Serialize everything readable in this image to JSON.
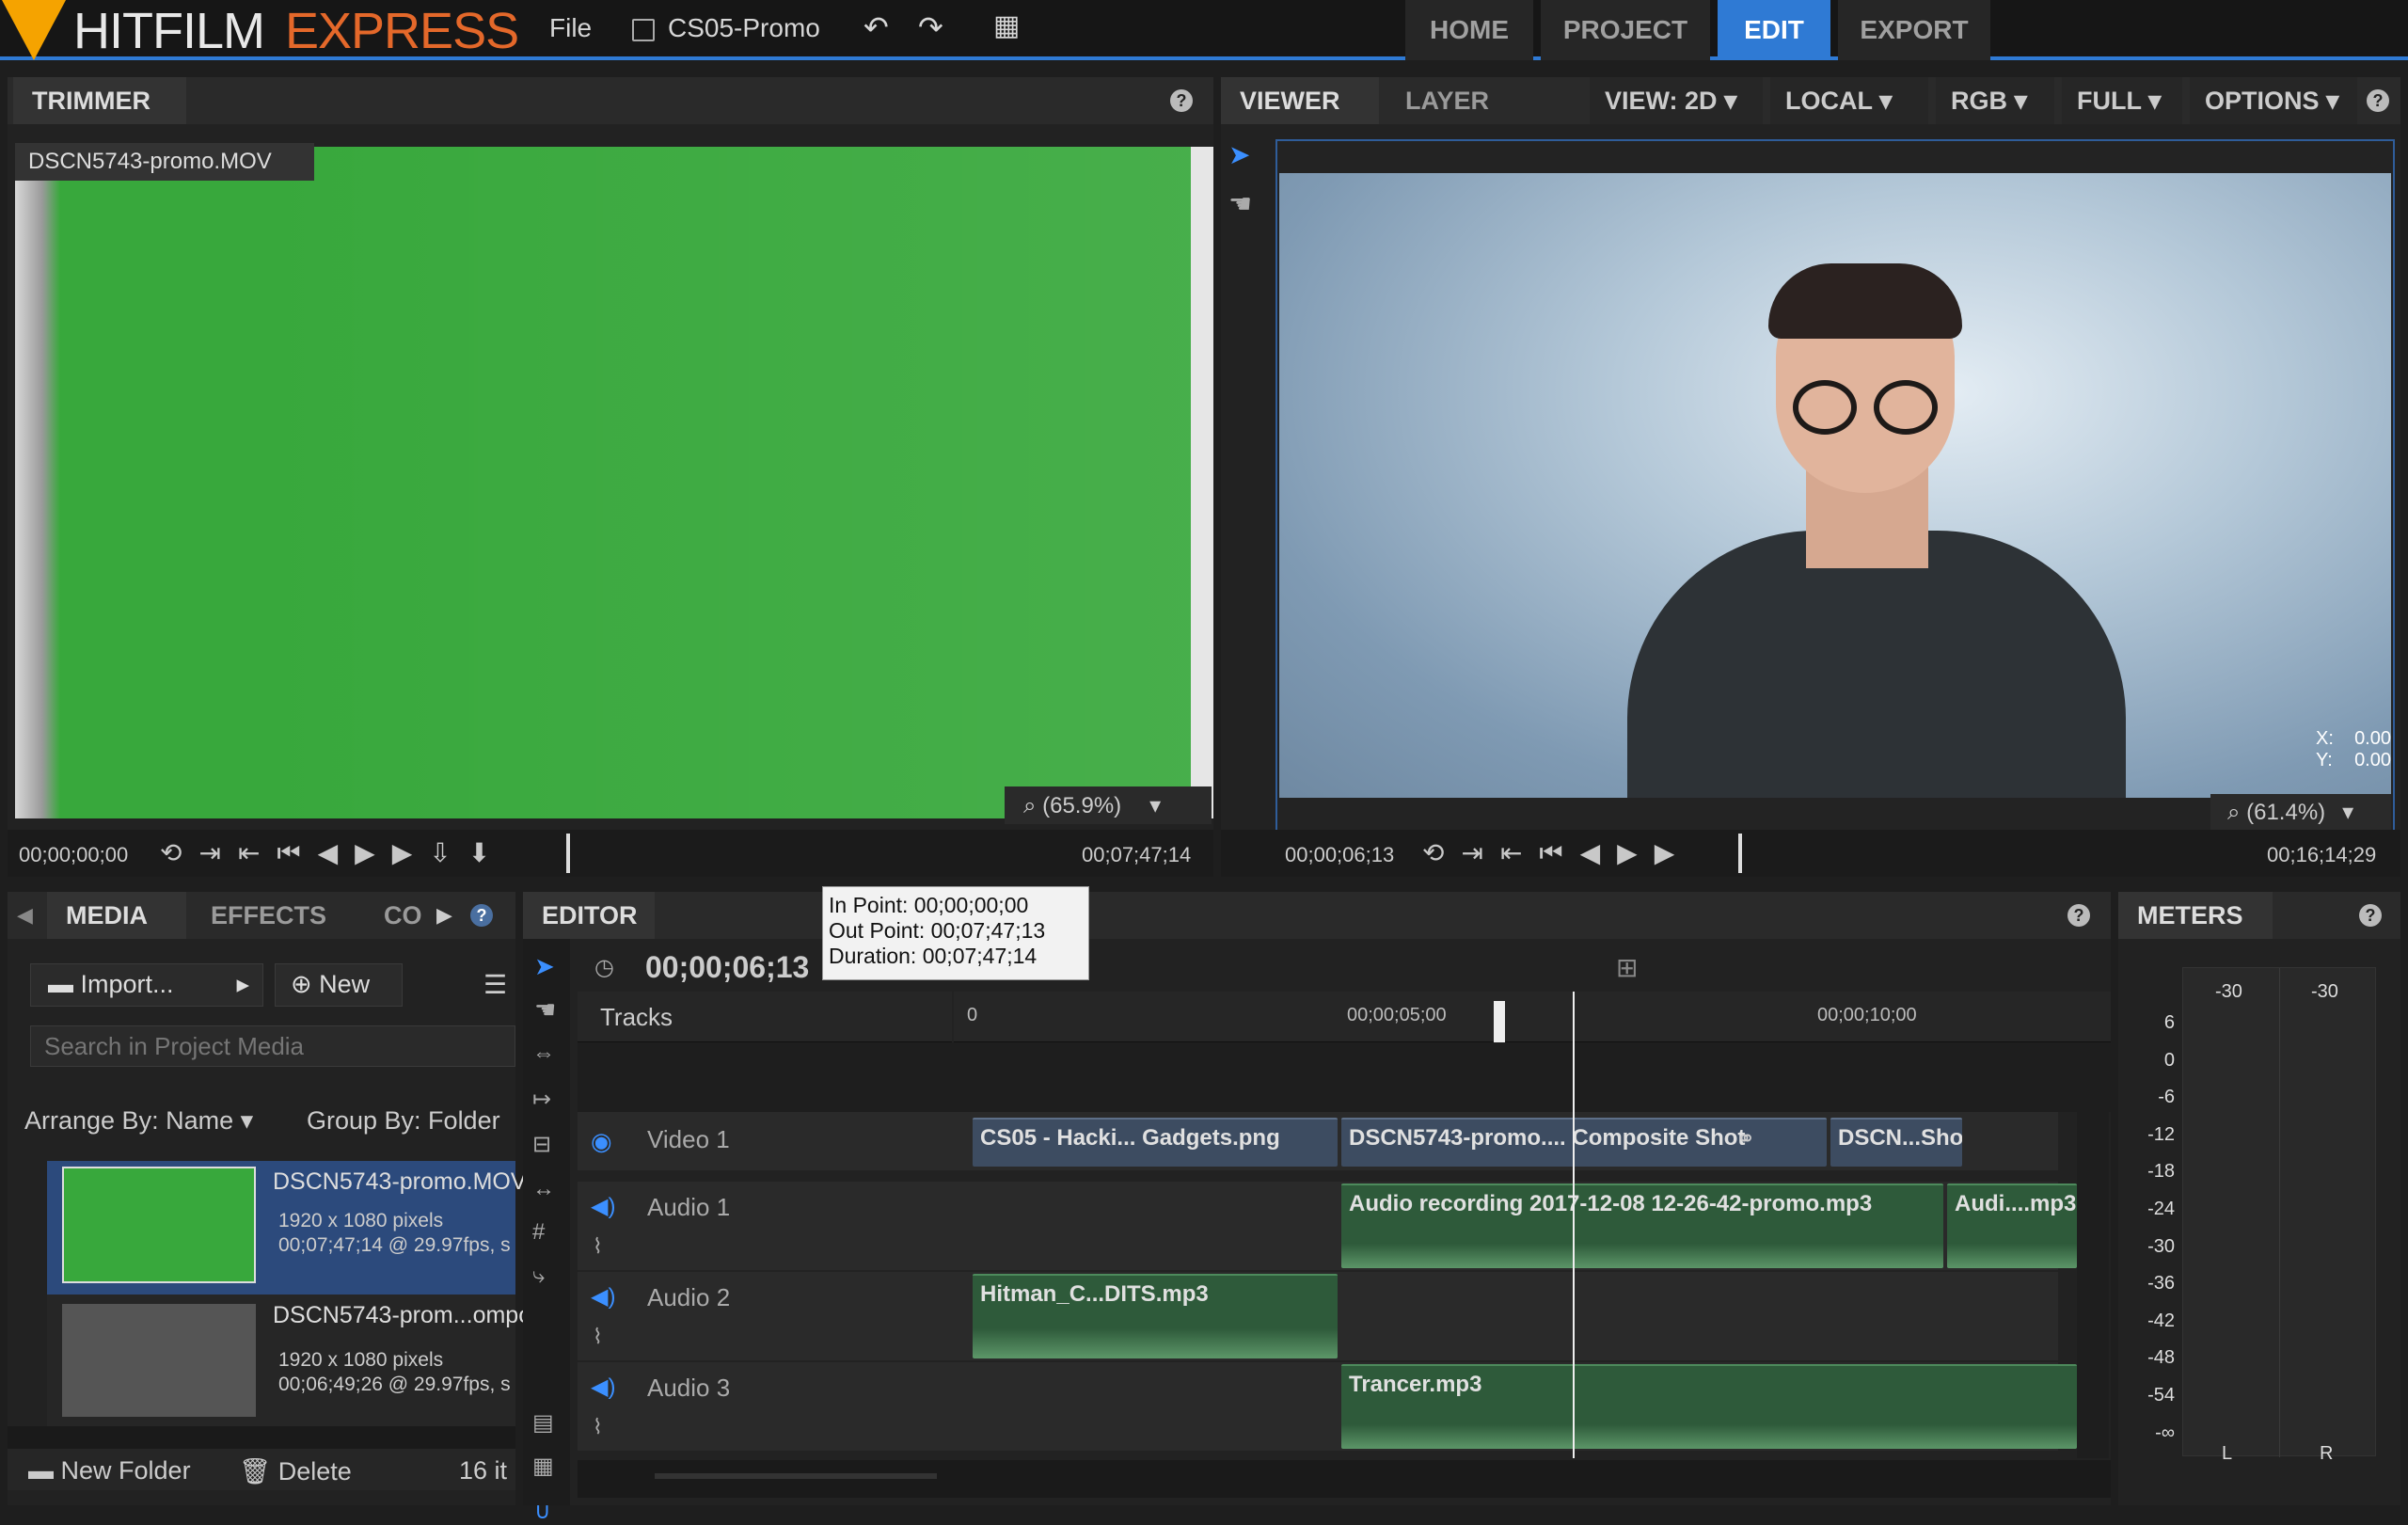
{
  "app": {
    "name_left": "HITFILM",
    "name_right": "EXPRESS",
    "file_menu": "File",
    "project_name": "CS05-Promo"
  },
  "nav": {
    "tabs": [
      "HOME",
      "PROJECT",
      "EDIT",
      "EXPORT"
    ],
    "active": "EDIT"
  },
  "trimmer": {
    "tab": "TRIMMER",
    "clip_label": "DSCN5743-promo.MOV",
    "zoom": "(65.9%)",
    "time_left": "00;00;00;00",
    "time_right": "00;07;47;14"
  },
  "viewer": {
    "tabs": [
      "VIEWER",
      "LAYER"
    ],
    "view": "VIEW: 2D",
    "local": "LOCAL",
    "rgb": "RGB",
    "full": "FULL",
    "options": "OPTIONS",
    "x_label": "X:",
    "x_val": "0.00",
    "y_label": "Y:",
    "y_val": "0.00",
    "zoom": "(61.4%)",
    "time_left": "00;00;06;13",
    "time_right": "00;16;14;29"
  },
  "media": {
    "tabs": [
      "MEDIA",
      "EFFECTS",
      "CO"
    ],
    "import": "Import...",
    "new": "New",
    "search_placeholder": "Search in Project Media",
    "arrange": "Arrange By: Name",
    "group": "Group By: Folder",
    "items": [
      {
        "name": "DSCN5743-promo.MOV",
        "res": "1920 x 1080 pixels",
        "dur": "00;07;47;14 @ 29.97fps, s"
      },
      {
        "name": "DSCN5743-prom...ompo",
        "res": "1920 x 1080 pixels",
        "dur": "00;06;49;26 @ 29.97fps, s"
      }
    ],
    "new_folder": "New Folder",
    "delete": "Delete",
    "count": "16 it"
  },
  "editor": {
    "tab": "EDITOR",
    "timecode": "00;00;06;13",
    "tracks_label": "Tracks",
    "tooltip": {
      "in": "In Point: 00;00;00;00",
      "out": "Out Point: 00;07;47;13",
      "dur": "Duration: 00;07;47;14"
    },
    "ruler": [
      "0",
      "00;00;05;00",
      "00;00;10;00"
    ],
    "tracks": [
      {
        "name": "Video 1"
      },
      {
        "name": "Audio 1"
      },
      {
        "name": "Audio 2"
      },
      {
        "name": "Audio 3"
      }
    ],
    "clips": {
      "v1a": "CS05 - Hacki... Gadgets.png",
      "v1b": "DSCN5743-promo.... Composite Shot",
      "v1c": "DSCN...Shot",
      "a1a": "Audio recording 2017-12-08 12-26-42-promo.mp3",
      "a1b": "Audi....mp3",
      "a2a": "Hitman_C...DITS.mp3",
      "a3a": "Trancer.mp3"
    }
  },
  "meters": {
    "tab": "METERS",
    "top_left": "-30",
    "top_right": "-30",
    "scale": [
      "6",
      "0",
      "-6",
      "-12",
      "-18",
      "-24",
      "-30",
      "-36",
      "-42",
      "-48",
      "-54",
      "-∞"
    ],
    "left": "L",
    "right": "R"
  }
}
